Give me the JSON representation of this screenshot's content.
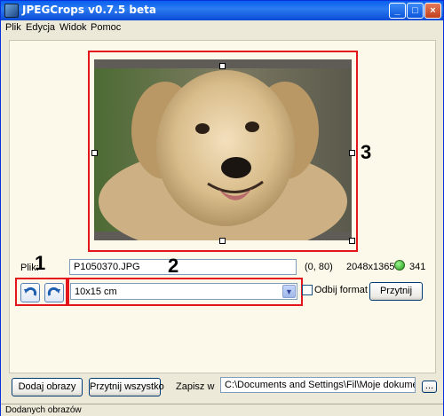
{
  "window": {
    "title": "JPEGCrops v0.7.5 beta"
  },
  "menu": [
    "Plik",
    "Edycja",
    "Widok",
    "Pomoc"
  ],
  "annotations": [
    "1",
    "2",
    "3"
  ],
  "file": {
    "label": "Plik:",
    "name": "P1050370.JPG",
    "offset": "(0, 80)",
    "dimensions": "2048x1365",
    "count": "341"
  },
  "crop": {
    "format": "10x15 cm",
    "flip_label": "Odbij format",
    "crop_button": "Przytnij"
  },
  "bottom": {
    "add_button": "Dodaj obrazy",
    "crop_all_button": "Przytnij wszystko",
    "save_label": "Zapisz w",
    "save_path": "C:\\Documents and Settings\\Fil\\Moje dokumenty\\Cro",
    "browse_button": "..."
  },
  "status": {
    "text": "Dodanych obrazów"
  },
  "colors": {
    "accent": "#0a5ff0",
    "highlight": "#e2161b",
    "status_ok": "#1f9b17"
  }
}
